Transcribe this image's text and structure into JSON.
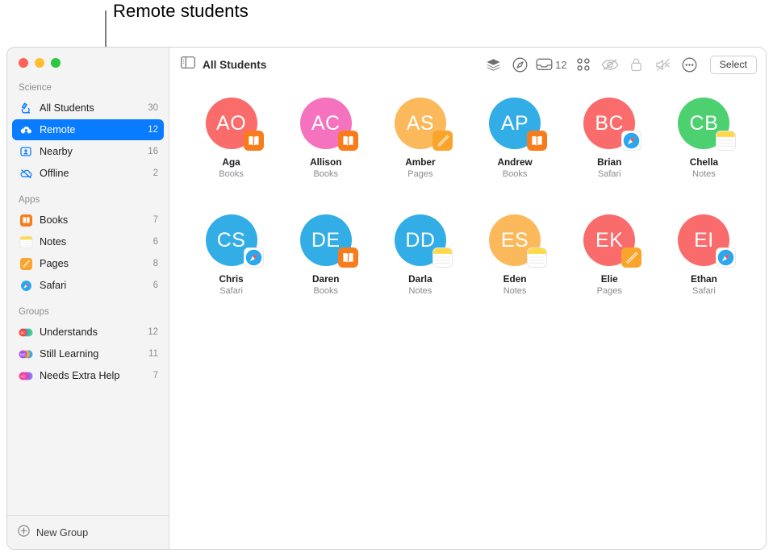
{
  "annotation": {
    "label": "Remote students"
  },
  "window": {
    "traffic_lights": [
      "close",
      "minimize",
      "zoom"
    ]
  },
  "sidebar": {
    "sections": [
      {
        "header": "Science",
        "items": [
          {
            "label": "All Students",
            "count": "30",
            "icon": "microscope-icon",
            "selected": false
          },
          {
            "label": "Remote",
            "count": "12",
            "icon": "cloud-person-icon",
            "selected": true
          },
          {
            "label": "Nearby",
            "count": "16",
            "icon": "person-frame-icon",
            "selected": false
          },
          {
            "label": "Offline",
            "count": "2",
            "icon": "cloud-slash-icon",
            "selected": false
          }
        ]
      },
      {
        "header": "Apps",
        "items": [
          {
            "label": "Books",
            "count": "7",
            "icon": "books-app-icon",
            "selected": false
          },
          {
            "label": "Notes",
            "count": "6",
            "icon": "notes-app-icon",
            "selected": false
          },
          {
            "label": "Pages",
            "count": "8",
            "icon": "pages-app-icon",
            "selected": false
          },
          {
            "label": "Safari",
            "count": "6",
            "icon": "safari-app-icon",
            "selected": false
          }
        ]
      },
      {
        "header": "Groups",
        "items": [
          {
            "label": "Understands",
            "count": "12",
            "icon": "group-avatars-icon",
            "selected": false
          },
          {
            "label": "Still Learning",
            "count": "11",
            "icon": "group-avatars-icon",
            "selected": false
          },
          {
            "label": "Needs Extra Help",
            "count": "7",
            "icon": "group-avatars-icon",
            "selected": false
          }
        ]
      }
    ],
    "new_group": {
      "label": "New Group",
      "icon": "plus-circle-icon"
    }
  },
  "toolbar": {
    "sidebar_toggle_icon": "sidebar-toggle-icon",
    "title": "All Students",
    "buttons": [
      {
        "name": "screens-layers-icon",
        "label": ""
      },
      {
        "name": "navigate-compass-icon",
        "label": ""
      },
      {
        "name": "inbox-icon",
        "label": "12"
      },
      {
        "name": "grid-view-icon",
        "label": ""
      },
      {
        "name": "hide-screen-icon",
        "label": ""
      },
      {
        "name": "lock-screen-icon",
        "label": ""
      },
      {
        "name": "mute-icon",
        "label": ""
      },
      {
        "name": "more-ellipsis-icon",
        "label": ""
      }
    ],
    "select_label": "Select"
  },
  "students": [
    {
      "initials": "AO",
      "name": "Aga",
      "app": "Books",
      "color": "#fa6b6b",
      "badge": "books"
    },
    {
      "initials": "AC",
      "name": "Allison",
      "app": "Books",
      "color": "#f572be",
      "badge": "books"
    },
    {
      "initials": "AS",
      "name": "Amber",
      "app": "Pages",
      "color": "#fcb95c",
      "badge": "pages"
    },
    {
      "initials": "AP",
      "name": "Andrew",
      "app": "Books",
      "color": "#32ade6",
      "badge": "books"
    },
    {
      "initials": "BC",
      "name": "Brian",
      "app": "Safari",
      "color": "#fa6b6b",
      "badge": "safari"
    },
    {
      "initials": "CB",
      "name": "Chella",
      "app": "Notes",
      "color": "#4cd070",
      "badge": "notes"
    },
    {
      "initials": "CS",
      "name": "Chris",
      "app": "Safari",
      "color": "#32ade6",
      "badge": "safari"
    },
    {
      "initials": "DE",
      "name": "Daren",
      "app": "Books",
      "color": "#32ade6",
      "badge": "books"
    },
    {
      "initials": "DD",
      "name": "Darla",
      "app": "Notes",
      "color": "#32ade6",
      "badge": "notes"
    },
    {
      "initials": "ES",
      "name": "Eden",
      "app": "Notes",
      "color": "#fcb95c",
      "badge": "notes"
    },
    {
      "initials": "EK",
      "name": "Elie",
      "app": "Pages",
      "color": "#fa6b6b",
      "badge": "pages"
    },
    {
      "initials": "EI",
      "name": "Ethan",
      "app": "Safari",
      "color": "#fa6b6b",
      "badge": "safari"
    }
  ],
  "colors": {
    "selection_blue": "#0a7cff",
    "sidebar_bg": "#f4f4f4",
    "accent_orange": "#f97c1c"
  }
}
